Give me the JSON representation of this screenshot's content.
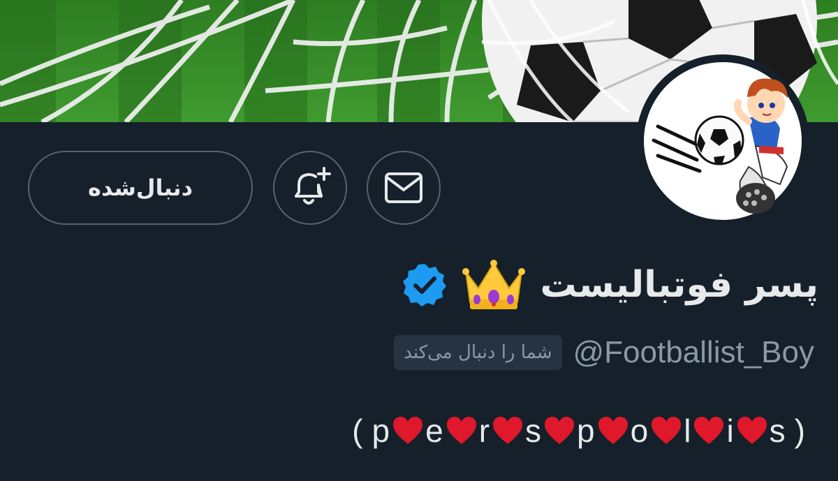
{
  "profile": {
    "display_name": "پسر فوتبالیست",
    "crown_emoji": "👑",
    "verified": true,
    "verified_color": "#1d9bf0",
    "handle": "@Footballist_Boy",
    "follows_you_label": "شما را دنبال می‌کند",
    "bio_letters": [
      "p",
      "e",
      "r",
      "s",
      "p",
      "o",
      "l",
      "i",
      "s"
    ],
    "bio_open": "(",
    "bio_close": ")",
    "bio_separator": "heart-emoji"
  },
  "actions": {
    "following_label": "دنبال‌شده",
    "notify_icon": "bell-plus-icon",
    "message_icon": "envelope-icon"
  },
  "colors": {
    "background": "#15202b",
    "text_primary": "#e7e9ea",
    "text_secondary": "#8b98a5",
    "button_border": "#536471",
    "heart": "#e0182b"
  }
}
